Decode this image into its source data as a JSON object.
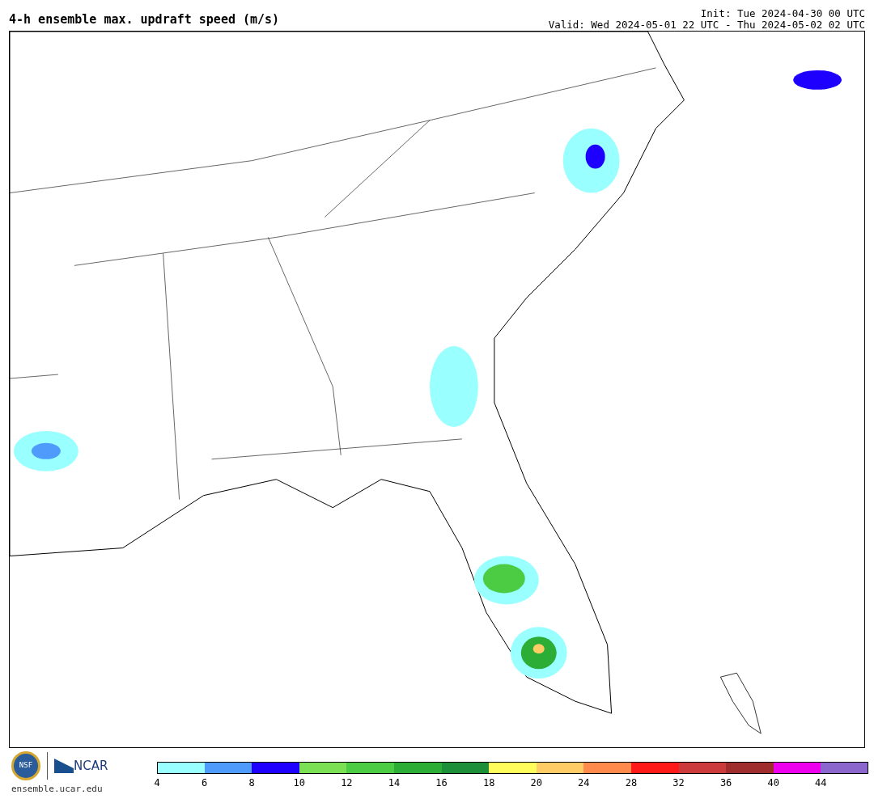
{
  "title": "4-h ensemble max. updraft speed (m/s)",
  "init": "Init: Tue 2024-04-30 00 UTC",
  "valid": "Valid: Wed 2024-05-01 22 UTC - Thu 2024-05-02 02 UTC",
  "logos": {
    "nsf": "NSF",
    "ncar": "NCAR",
    "site": "ensemble.ucar.edu"
  },
  "colorbar": [
    {
      "label": "4",
      "color": "#99ffff"
    },
    {
      "label": "6",
      "color": "#4f9bfb"
    },
    {
      "label": "8",
      "color": "#1e00ff"
    },
    {
      "label": "10",
      "color": "#7be054"
    },
    {
      "label": "12",
      "color": "#4bcc42"
    },
    {
      "label": "14",
      "color": "#2bad36"
    },
    {
      "label": "16",
      "color": "#1d8f39"
    },
    {
      "label": "18",
      "color": "#fffd5c"
    },
    {
      "label": "20",
      "color": "#ffcc66"
    },
    {
      "label": "24",
      "color": "#ff8a4b"
    },
    {
      "label": "28",
      "color": "#ff1a1a"
    },
    {
      "label": "32",
      "color": "#cc3b3b"
    },
    {
      "label": "36",
      "color": "#a02d2d"
    },
    {
      "label": "40",
      "color": "#ee00ee"
    },
    {
      "label": "44",
      "color": "#8b66cc"
    }
  ]
}
